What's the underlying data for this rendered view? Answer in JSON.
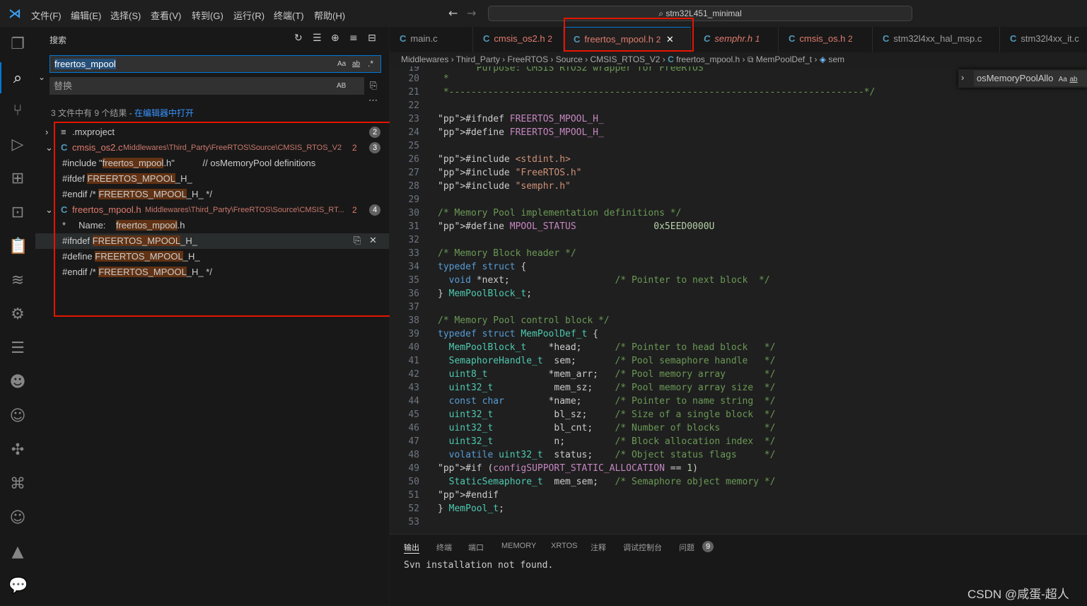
{
  "menu": [
    "文件(F)",
    "编辑(E)",
    "选择(S)",
    "查看(V)",
    "转到(G)",
    "运行(R)",
    "终端(T)",
    "帮助(H)"
  ],
  "command_center": {
    "text": "stm32L451_minimal"
  },
  "sidebar": {
    "title": "搜索",
    "search_value": "freertos_mpool",
    "search_opts": [
      "Aa",
      "ab",
      ".*"
    ],
    "replace_placeholder": "替换",
    "replace_opt": "AB",
    "summary": "3 文件中有 9 个结果 - ",
    "summary_link": "在编辑器中打开",
    "results": [
      {
        "file": ".mxproject",
        "path": "",
        "count": "2",
        "icon": "list-icon"
      },
      {
        "file": "cmsis_os2.c",
        "path": "Middlewares\\Third_Party\\FreeRTOS\\Source\\CMSIS_RTOS_V2",
        "count": "3",
        "extra": "2",
        "icon": "c-icon",
        "matches": [
          {
            "pre": "#include \"",
            "hit": "freertos_mpool",
            "post": ".h\"           // osMemoryPool definitions"
          },
          {
            "pre": "#ifdef ",
            "hit": "FREERTOS_MPOOL",
            "post": "_H_"
          },
          {
            "pre": "#endif /* ",
            "hit": "FREERTOS_MPOOL",
            "post": "_H_ */"
          }
        ]
      },
      {
        "file": "freertos_mpool.h",
        "path": "Middlewares\\Third_Party\\FreeRTOS\\Source\\CMSIS_RT...",
        "count": "4",
        "extra": "2",
        "icon": "c-icon",
        "matches": [
          {
            "pre": "*     Name:    ",
            "hit": "freertos_mpool",
            "post": ".h"
          },
          {
            "pre": "#ifndef ",
            "hit": "FREERTOS_MPOOL",
            "post": "_H_"
          },
          {
            "pre": "#define ",
            "hit": "FREERTOS_MPOOL",
            "post": "_H_"
          },
          {
            "pre": "#endif /* ",
            "hit": "FREERTOS_MPOOL",
            "post": "_H_ */"
          }
        ]
      }
    ]
  },
  "tabs": [
    {
      "label": "main.c",
      "badge": ""
    },
    {
      "label": "cmsis_os2.h",
      "badge": "2"
    },
    {
      "label": "freertos_mpool.h",
      "badge": "2",
      "active": true
    },
    {
      "label": "semphr.h",
      "badge": "1"
    },
    {
      "label": "cmsis_os.h",
      "badge": "2"
    },
    {
      "label": "stm32l4xx_hal_msp.c",
      "badge": ""
    },
    {
      "label": "stm32l4xx_it.c",
      "badge": ""
    }
  ],
  "breadcrumb": [
    "Middlewares",
    "Third_Party",
    "FreeRTOS",
    "Source",
    "CMSIS_RTOS_V2",
    "freertos_mpool.h",
    "MemPoolDef_t",
    "sem"
  ],
  "find_widget": {
    "value": "osMemoryPoolAllo",
    "opts": [
      "Aa",
      "ab"
    ]
  },
  "code": {
    "first_line": 19,
    "partial_line": "       Purpose: CMSIS RTOS2 wrapper for FreeRTOS",
    "lines": [
      " *",
      " *---------------------------------------------------------------------------*/",
      "",
      "#ifndef FREERTOS_MPOOL_H_",
      "#define FREERTOS_MPOOL_H_",
      "",
      "#include <stdint.h>",
      "#include \"FreeRTOS.h\"",
      "#include \"semphr.h\"",
      "",
      "/* Memory Pool implementation definitions */",
      "#define MPOOL_STATUS              0x5EED0000U",
      "",
      "/* Memory Block header */",
      "typedef struct {",
      "  void *next;                   /* Pointer to next block  */",
      "} MemPoolBlock_t;",
      "",
      "/* Memory Pool control block */",
      "typedef struct MemPoolDef_t {",
      "  MemPoolBlock_t    *head;      /* Pointer to head block   */",
      "  SemaphoreHandle_t  sem;       /* Pool semaphore handle   */",
      "  uint8_t           *mem_arr;   /* Pool memory array       */",
      "  uint32_t           mem_sz;    /* Pool memory array size  */",
      "  const char        *name;      /* Pointer to name string  */",
      "  uint32_t           bl_sz;     /* Size of a single block  */",
      "  uint32_t           bl_cnt;    /* Number of blocks        */",
      "  uint32_t           n;         /* Block allocation index  */",
      "  volatile uint32_t  status;    /* Object status flags     */",
      "#if (configSUPPORT_STATIC_ALLOCATION == 1)",
      "  StaticSemaphore_t  mem_sem;   /* Semaphore object memory */",
      "#endif",
      "} MemPool_t;",
      ""
    ]
  },
  "panel": {
    "tabs": [
      "输出",
      "终端",
      "端口",
      "MEMORY",
      "XRTOS",
      "注释",
      "调试控制台",
      "问题"
    ],
    "problems_count": "9",
    "output": "Svn installation not found."
  },
  "watermark": "CSDN @咸蛋-超人",
  "colors": {
    "accent": "#0078d4",
    "match_bg": "#613214",
    "red_box": "#e51400"
  }
}
